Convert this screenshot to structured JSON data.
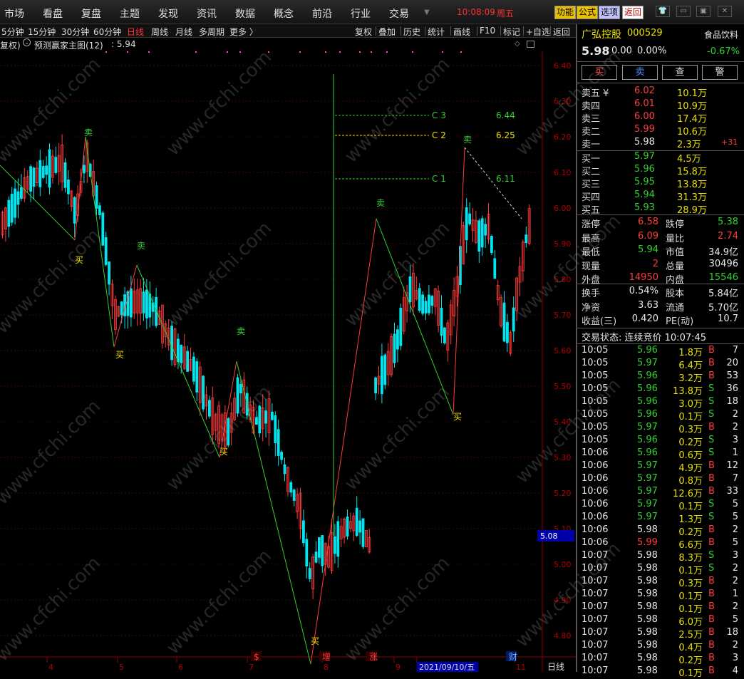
{
  "menu": [
    "市场",
    "看盘",
    "复盘",
    "主题",
    "发现",
    "资讯",
    "数据",
    "概念",
    "前沿",
    "行业",
    "交易"
  ],
  "clock": "10:08:09",
  "weekday": "周五",
  "top_buttons": [
    {
      "label": "功能",
      "bg": "#e8c000",
      "fg": "#000"
    },
    {
      "label": "公式",
      "bg": "#e8c000",
      "fg": "#000"
    },
    {
      "label": "选项",
      "bg": "#c0c0ff",
      "fg": "#000"
    },
    {
      "label": "返回",
      "bg": "#ffffff",
      "fg": "#c00000"
    }
  ],
  "window_icons": [
    "shirt-icon",
    "minimize-icon",
    "restore-icon",
    "close-icon"
  ],
  "periods": [
    {
      "label": "5分钟",
      "active": false
    },
    {
      "label": "15分钟",
      "active": false
    },
    {
      "label": "30分钟",
      "active": false
    },
    {
      "label": "60分钟",
      "active": false
    },
    {
      "label": "日线",
      "active": true
    },
    {
      "label": "周线",
      "active": false
    },
    {
      "label": "月线",
      "active": false
    },
    {
      "label": "多周期",
      "active": false
    },
    {
      "label": "更多 〉",
      "active": false
    }
  ],
  "tools": [
    "复权",
    "叠加",
    "历史",
    "统计",
    "画线",
    "F10",
    "标记",
    "+自选",
    "返回"
  ],
  "info": {
    "fq": "复权)",
    "indicator": "预测赢家主图(12)",
    "value": ": 5.94"
  },
  "chart_data": {
    "type": "candlestick",
    "y_ticks": [
      "6.40",
      "6.30",
      "6.20",
      "6.10",
      "6.00",
      "5.90",
      "5.80",
      "5.70",
      "5.60",
      "5.50",
      "5.40",
      "5.30",
      "5.20",
      "5.10",
      "5.00",
      "4.90",
      "4.80"
    ],
    "ylim": [
      4.76,
      6.44
    ],
    "current_price_label": "5.08",
    "x_ticks": [
      "4",
      "5",
      "6",
      "7",
      "8",
      "9",
      "2021/09/10/五",
      "11"
    ],
    "period_label": "日线",
    "event_marks": [
      "$",
      "增",
      "涨",
      "财"
    ],
    "targets": [
      {
        "label": "C 3",
        "value": "6.44",
        "color": "#30d030"
      },
      {
        "label": "C 2",
        "value": "6.25",
        "color": "#e8e000"
      },
      {
        "label": "C 1",
        "value": "6.11",
        "color": "#30d030"
      }
    ],
    "signals": [
      {
        "text": "卖",
        "kind": "sell",
        "date_index": 0
      },
      {
        "text": "买",
        "kind": "buy",
        "date_index": 1
      },
      {
        "text": "卖",
        "kind": "sell",
        "date_index": 2
      },
      {
        "text": "买",
        "kind": "buy",
        "date_index": 3
      },
      {
        "text": "卖",
        "kind": "sell",
        "date_index": 4
      },
      {
        "text": "买",
        "kind": "buy",
        "date_index": 5
      },
      {
        "text": "买",
        "kind": "buy",
        "date_index": 6
      },
      {
        "text": "卖",
        "kind": "sell",
        "date_index": 7
      },
      {
        "text": "买",
        "kind": "buy",
        "date_index": 8
      },
      {
        "text": "卖",
        "kind": "sell",
        "date_index": 9
      }
    ],
    "zigzag": [
      6.12,
      5.91,
      6.2,
      5.61,
      5.84,
      5.3,
      5.57,
      4.72,
      5.97,
      5.42,
      6.17,
      5.97
    ],
    "candles": []
  },
  "quote": {
    "name": "广弘控股",
    "code": "000529",
    "industry": "食品饮料",
    "price": "5.98",
    "change": "0.00",
    "pct": "0.00%",
    "industry_pct": "-0.67%"
  },
  "actions": [
    "买",
    "卖",
    "查",
    "警"
  ],
  "sells": [
    {
      "label": "卖五 ¥",
      "price": "6.02",
      "vol": "10.1万",
      "pc": "r"
    },
    {
      "label": "卖四",
      "price": "6.01",
      "vol": "10.9万",
      "pc": "r"
    },
    {
      "label": "卖三",
      "price": "6.00",
      "vol": "17.4万",
      "pc": "r"
    },
    {
      "label": "卖二",
      "price": "5.99",
      "vol": "10.6万",
      "pc": "r"
    },
    {
      "label": "卖一",
      "price": "5.98",
      "vol": "2.3万",
      "pc": "w",
      "extra": "+31"
    }
  ],
  "buys": [
    {
      "label": "买一",
      "price": "5.97",
      "vol": "4.5万",
      "pc": "g"
    },
    {
      "label": "买二",
      "price": "5.96",
      "vol": "15.8万",
      "pc": "g"
    },
    {
      "label": "买三",
      "price": "5.95",
      "vol": "13.8万",
      "pc": "g"
    },
    {
      "label": "买四",
      "price": "5.94",
      "vol": "31.3万",
      "pc": "g"
    },
    {
      "label": "买五",
      "price": "5.93",
      "vol": "28.9万",
      "pc": "g"
    }
  ],
  "stats": [
    {
      "l1": "涨停",
      "v1": "6.58",
      "c1": "r",
      "l2": "跌停",
      "v2": "5.38",
      "c2": "g"
    },
    {
      "l1": "最高",
      "v1": "6.09",
      "c1": "r",
      "l2": "量比",
      "v2": "2.74",
      "c2": "r"
    },
    {
      "l1": "最低",
      "v1": "5.94",
      "c1": "g",
      "l2": "市值",
      "v2": "34.9亿",
      "c2": "w"
    },
    {
      "l1": "现量",
      "v1": "2",
      "c1": "r",
      "l2": "总量",
      "v2": "30496",
      "c2": "w"
    },
    {
      "l1": "外盘",
      "v1": "14950",
      "c1": "r",
      "l2": "内盘",
      "v2": "15546",
      "c2": "g"
    }
  ],
  "stats2": [
    {
      "l1": "换手",
      "v1": "0.54%",
      "c1": "w",
      "l2": "股本",
      "v2": "5.84亿",
      "c2": "w"
    },
    {
      "l1": "净资",
      "v1": "3.63",
      "c1": "w",
      "l2": "流通",
      "v2": "5.70亿",
      "c2": "w"
    },
    {
      "l1": "收益(三)",
      "v1": "0.420",
      "c1": "w",
      "l2": "PE(动)",
      "v2": "10.7",
      "c2": "w"
    }
  ],
  "trade_status": "交易状态: 连续竞价 10:07:45",
  "ticks": [
    {
      "t": "10:05",
      "p": "5.96",
      "pc": "g",
      "v": "1.8万",
      "s": "B",
      "n": "7"
    },
    {
      "t": "10:05",
      "p": "5.97",
      "pc": "g",
      "v": "6.4万",
      "s": "B",
      "n": "20"
    },
    {
      "t": "10:05",
      "p": "5.96",
      "pc": "g",
      "v": "3.2万",
      "s": "B",
      "n": "53"
    },
    {
      "t": "10:05",
      "p": "5.96",
      "pc": "g",
      "v": "13.8万",
      "s": "S",
      "n": "36"
    },
    {
      "t": "10:05",
      "p": "5.96",
      "pc": "g",
      "v": "3.0万",
      "s": "S",
      "n": "18"
    },
    {
      "t": "10:05",
      "p": "5.96",
      "pc": "g",
      "v": "0.1万",
      "s": "S",
      "n": "2"
    },
    {
      "t": "10:05",
      "p": "5.97",
      "pc": "g",
      "v": "0.3万",
      "s": "B",
      "n": "2"
    },
    {
      "t": "10:05",
      "p": "5.96",
      "pc": "g",
      "v": "0.2万",
      "s": "S",
      "n": "3"
    },
    {
      "t": "10:06",
      "p": "5.96",
      "pc": "g",
      "v": "0.6万",
      "s": "S",
      "n": "1"
    },
    {
      "t": "10:06",
      "p": "5.97",
      "pc": "g",
      "v": "4.9万",
      "s": "B",
      "n": "12"
    },
    {
      "t": "10:06",
      "p": "5.97",
      "pc": "g",
      "v": "0.8万",
      "s": "B",
      "n": "7"
    },
    {
      "t": "10:06",
      "p": "5.97",
      "pc": "g",
      "v": "12.6万",
      "s": "B",
      "n": "33"
    },
    {
      "t": "10:06",
      "p": "5.97",
      "pc": "g",
      "v": "0.1万",
      "s": "S",
      "n": "5"
    },
    {
      "t": "10:06",
      "p": "5.97",
      "pc": "g",
      "v": "1.3万",
      "s": "S",
      "n": "5"
    },
    {
      "t": "10:06",
      "p": "5.98",
      "pc": "w",
      "v": "0.2万",
      "s": "B",
      "n": "2"
    },
    {
      "t": "10:06",
      "p": "5.99",
      "pc": "r",
      "v": "6.6万",
      "s": "B",
      "n": "5"
    },
    {
      "t": "10:07",
      "p": "5.98",
      "pc": "w",
      "v": "8.3万",
      "s": "S",
      "n": "3"
    },
    {
      "t": "10:07",
      "p": "5.98",
      "pc": "w",
      "v": "0.1万",
      "s": "S",
      "n": "2"
    },
    {
      "t": "10:07",
      "p": "5.98",
      "pc": "w",
      "v": "0.3万",
      "s": "B",
      "n": "2"
    },
    {
      "t": "10:07",
      "p": "5.98",
      "pc": "w",
      "v": "0.1万",
      "s": "B",
      "n": "1"
    },
    {
      "t": "10:07",
      "p": "5.98",
      "pc": "w",
      "v": "0.1万",
      "s": "B",
      "n": "2"
    },
    {
      "t": "10:07",
      "p": "5.98",
      "pc": "w",
      "v": "6.0万",
      "s": "B",
      "n": "5"
    },
    {
      "t": "10:07",
      "p": "5.98",
      "pc": "w",
      "v": "2.5万",
      "s": "B",
      "n": "18"
    },
    {
      "t": "10:07",
      "p": "5.98",
      "pc": "w",
      "v": "0.4万",
      "s": "B",
      "n": "2"
    },
    {
      "t": "10:07",
      "p": "5.98",
      "pc": "w",
      "v": "0.2万",
      "s": "B",
      "n": "3"
    },
    {
      "t": "10:07",
      "p": "5.98",
      "pc": "w",
      "v": "0.1万",
      "s": "B",
      "n": "4"
    }
  ],
  "watermark": "www.cfchi.com",
  "colors": {
    "up": "#ff3b3b",
    "down": "#00e5ee",
    "zigzag_down": "#30d030",
    "zigzag_up": "#ff3b3b",
    "axis": "#b00000"
  }
}
